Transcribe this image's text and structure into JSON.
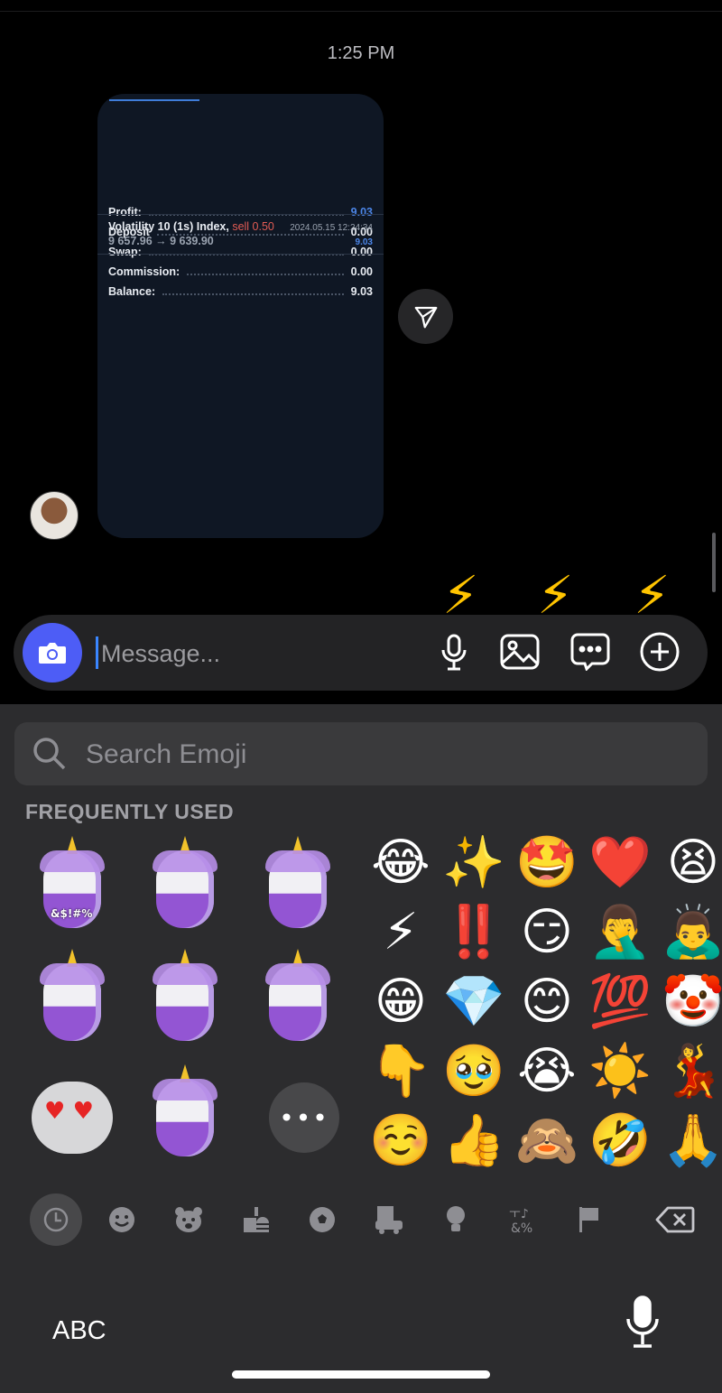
{
  "chat": {
    "timestamp": "1:25 PM",
    "trade_card": {
      "rows": [
        {
          "label": "Profit:",
          "value": "9.03",
          "highlight": true
        },
        {
          "label": "Deposit",
          "value": "0.00",
          "highlight": false
        },
        {
          "label": "Swap:",
          "value": "0.00",
          "highlight": false
        },
        {
          "label": "Commission:",
          "value": "0.00",
          "highlight": false
        },
        {
          "label": "Balance:",
          "value": "9.03",
          "highlight": false
        }
      ],
      "trade": {
        "symbol": "Volatility 10 (1s) Index,",
        "side": "sell 0.50",
        "prices": "9 657.96 → 9 639.90",
        "datetime": "2024.05.15 12:24:34",
        "profit": "9.03"
      }
    },
    "reaction_emoji": "⚡"
  },
  "composer": {
    "placeholder": "Message...",
    "buttons": [
      "camera",
      "microphone",
      "gallery",
      "sticker",
      "add"
    ]
  },
  "emoji_keyboard": {
    "search_placeholder": "Search Emoji",
    "section_title": "FREQUENTLY USED",
    "memoji_overlays": {
      "swear": "&$!#%"
    },
    "more_label": "•••",
    "emojis": [
      [
        "😂",
        "✨",
        "🤩",
        "❤️",
        "😫"
      ],
      [
        "⚡",
        "‼️",
        "😏",
        "🤦‍♂️",
        "🙇‍♂️"
      ],
      [
        "😁",
        "💎",
        "😊",
        "💯",
        "🤡"
      ],
      [
        "👇",
        "🥹",
        "😭",
        "☀️",
        "💃"
      ],
      [
        "☺️",
        "👍",
        "🙈",
        "🤣",
        "🙏"
      ]
    ],
    "categories": [
      "recent",
      "smileys",
      "animals",
      "food",
      "activity",
      "travel",
      "objects",
      "symbols",
      "flags"
    ],
    "abc_label": "ABC"
  },
  "colors": {
    "accent": "#4d5df6",
    "profit_blue": "#4c86e8",
    "sell_red": "#e25c54",
    "keyboard_bg": "#2c2c2e"
  }
}
